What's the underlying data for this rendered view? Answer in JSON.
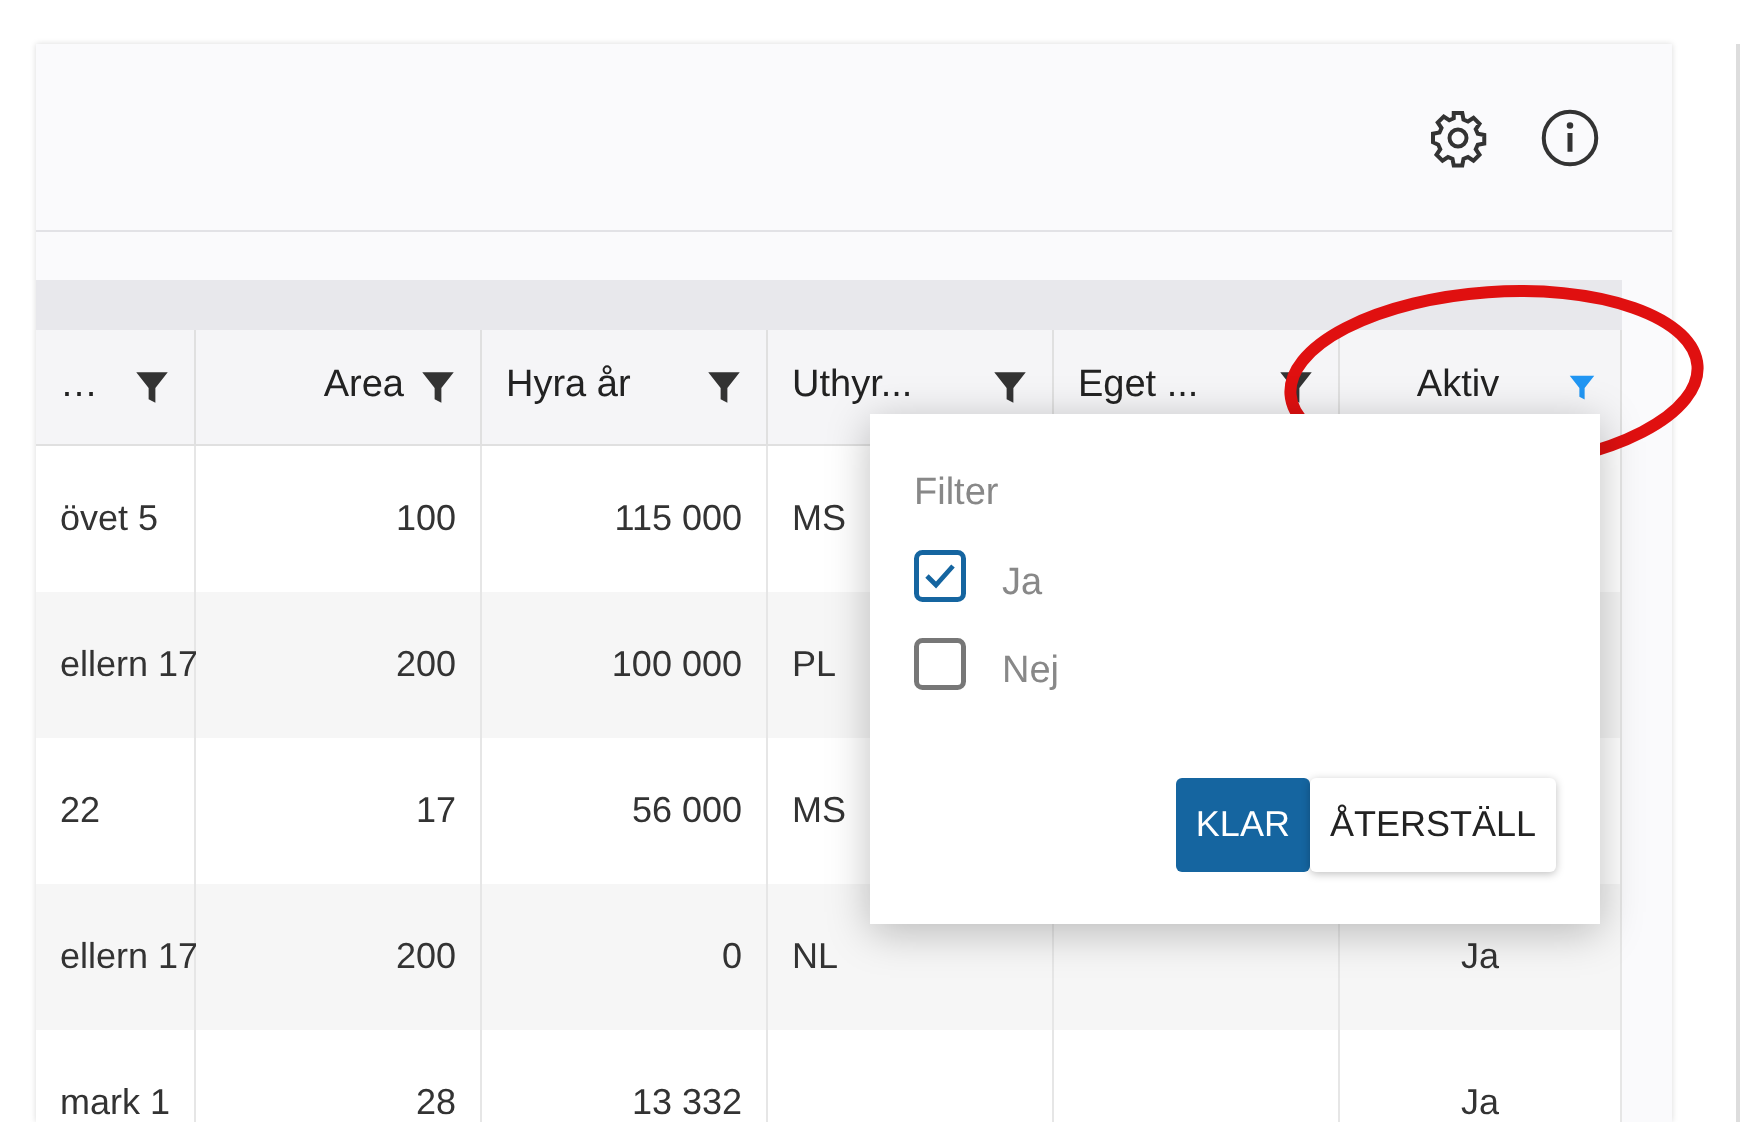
{
  "table": {
    "columns": [
      {
        "label": "…",
        "filter_active": false
      },
      {
        "label": "Area",
        "filter_active": false
      },
      {
        "label": "Hyra år",
        "filter_active": false
      },
      {
        "label": "Uthyr...",
        "filter_active": false
      },
      {
        "label": "Eget ...",
        "filter_active": false
      },
      {
        "label": "Aktiv",
        "filter_active": true
      }
    ],
    "rows": [
      {
        "cells": [
          "övet 5",
          "100",
          "115 000",
          "MS",
          null,
          null
        ]
      },
      {
        "cells": [
          "ellern 17",
          "200",
          "100 000",
          "PL",
          null,
          null
        ]
      },
      {
        "cells": [
          "22",
          "17",
          "56 000",
          "MS",
          null,
          null
        ]
      },
      {
        "cells": [
          "ellern 17",
          "200",
          "0",
          "NL",
          null,
          "Ja"
        ]
      },
      {
        "cells": [
          "mark 1",
          "28",
          "13 332",
          null,
          null,
          "Ja"
        ]
      }
    ]
  },
  "filter_popup": {
    "title": "Filter",
    "options": [
      {
        "label": "Ja",
        "checked": true
      },
      {
        "label": "Nej",
        "checked": false
      }
    ],
    "buttons": [
      {
        "label": "KLAR",
        "kind": "primary"
      },
      {
        "label": "ÅTERSTÄLL",
        "kind": "secondary"
      }
    ]
  }
}
